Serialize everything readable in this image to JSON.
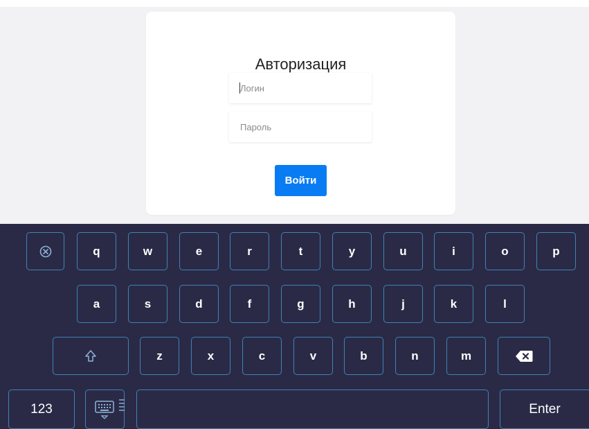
{
  "login": {
    "title": "Авторизация",
    "login_placeholder": "Логин",
    "login_value": "",
    "password_placeholder": "Пароль",
    "password_value": "",
    "submit_label": "Войти"
  },
  "keyboard": {
    "row1": [
      "q",
      "w",
      "e",
      "r",
      "t",
      "y",
      "u",
      "i",
      "o",
      "p"
    ],
    "row2": [
      "a",
      "s",
      "d",
      "f",
      "g",
      "h",
      "j",
      "k",
      "l"
    ],
    "row3": [
      "z",
      "x",
      "c",
      "v",
      "b",
      "n",
      "m"
    ],
    "numbers_label": "123",
    "enter_label": "Enter",
    "icons": {
      "close": "close-circle-icon",
      "shift": "shift-arrow-icon",
      "backspace": "backspace-icon",
      "layout": "keyboard-icon"
    }
  },
  "colors": {
    "keyboard_bg": "#2a2a47",
    "key_border": "#3f83b3",
    "accent": "#0a7cf3"
  }
}
